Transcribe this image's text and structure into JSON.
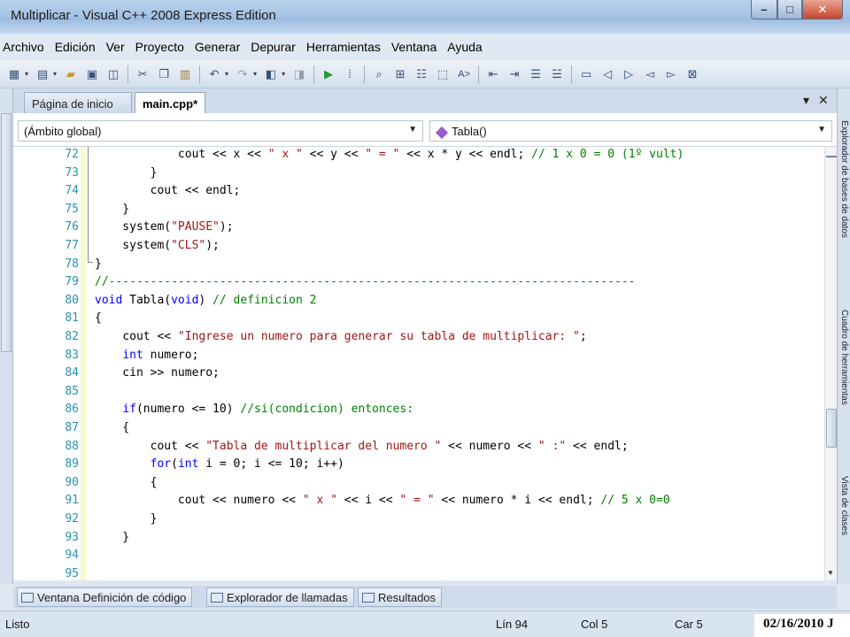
{
  "window": {
    "title": "Multiplicar - Visual C++ 2008 Express Edition"
  },
  "menu": [
    "Archivo",
    "Edición",
    "Ver",
    "Proyecto",
    "Generar",
    "Depurar",
    "Herramientas",
    "Ventana",
    "Ayuda"
  ],
  "tabs": {
    "start_page": "Página de inicio",
    "active": "main.cpp*"
  },
  "nav": {
    "scope": "(Ámbito global)",
    "member": "Tabla()"
  },
  "side_panels": {
    "right": [
      "Explorador de bases de datos",
      "Cuadro de herramientas",
      "Vista de clases"
    ]
  },
  "code_lines": [
    {
      "n": "72",
      "parts": [
        [
          "t",
          "            cout << x << "
        ],
        [
          "s",
          "\" x \""
        ],
        [
          "t",
          " << y << "
        ],
        [
          "s",
          "\" = \""
        ],
        [
          "t",
          " << x * y << endl; "
        ],
        [
          "c",
          "// 1 x 0 = 0 (1º vult)"
        ]
      ]
    },
    {
      "n": "73",
      "parts": [
        [
          "t",
          "        }"
        ]
      ]
    },
    {
      "n": "74",
      "parts": [
        [
          "t",
          "        cout << endl;"
        ]
      ]
    },
    {
      "n": "75",
      "parts": [
        [
          "t",
          "    }"
        ]
      ]
    },
    {
      "n": "76",
      "parts": [
        [
          "t",
          "    system("
        ],
        [
          "s",
          "\"PAUSE\""
        ],
        [
          "t",
          ");"
        ]
      ]
    },
    {
      "n": "77",
      "parts": [
        [
          "t",
          "    system("
        ],
        [
          "s",
          "\"CLS\""
        ],
        [
          "t",
          ");"
        ]
      ]
    },
    {
      "n": "78",
      "parts": [
        [
          "t",
          "}"
        ]
      ]
    },
    {
      "n": "79",
      "parts": [
        [
          "c",
          "//----------------------------------------------------------------------------"
        ]
      ]
    },
    {
      "n": "80",
      "parts": [
        [
          "k",
          "void"
        ],
        [
          "t",
          " Tabla("
        ],
        [
          "k",
          "void"
        ],
        [
          "t",
          ") "
        ],
        [
          "c",
          "// definicion 2"
        ]
      ]
    },
    {
      "n": "81",
      "parts": [
        [
          "t",
          "{"
        ]
      ]
    },
    {
      "n": "82",
      "parts": [
        [
          "t",
          "    cout << "
        ],
        [
          "s",
          "\"Ingrese un numero para generar su tabla de multiplicar: \""
        ],
        [
          "t",
          ";"
        ]
      ]
    },
    {
      "n": "83",
      "parts": [
        [
          "t",
          "    "
        ],
        [
          "k",
          "int"
        ],
        [
          "t",
          " numero;"
        ]
      ]
    },
    {
      "n": "84",
      "parts": [
        [
          "t",
          "    cin >> numero;"
        ]
      ]
    },
    {
      "n": "85",
      "parts": [
        [
          "t",
          ""
        ]
      ]
    },
    {
      "n": "86",
      "parts": [
        [
          "t",
          "    "
        ],
        [
          "k",
          "if"
        ],
        [
          "t",
          "(numero <= 10) "
        ],
        [
          "c",
          "//si(condicion) entonces:"
        ]
      ]
    },
    {
      "n": "87",
      "parts": [
        [
          "t",
          "    {"
        ]
      ]
    },
    {
      "n": "88",
      "parts": [
        [
          "t",
          "        cout << "
        ],
        [
          "s",
          "\"Tabla de multiplicar del numero \""
        ],
        [
          "t",
          " << numero << "
        ],
        [
          "s",
          "\" :\""
        ],
        [
          "t",
          " << endl;"
        ]
      ]
    },
    {
      "n": "89",
      "parts": [
        [
          "t",
          "        "
        ],
        [
          "k",
          "for"
        ],
        [
          "t",
          "("
        ],
        [
          "k",
          "int"
        ],
        [
          "t",
          " i = 0; i <= 10; i++)"
        ]
      ]
    },
    {
      "n": "90",
      "parts": [
        [
          "t",
          "        {"
        ]
      ]
    },
    {
      "n": "91",
      "parts": [
        [
          "t",
          "            cout << numero << "
        ],
        [
          "s",
          "\" x \""
        ],
        [
          "t",
          " << i << "
        ],
        [
          "s",
          "\" = \""
        ],
        [
          "t",
          " << numero * i << endl; "
        ],
        [
          "c",
          "// 5 x 0=0"
        ]
      ]
    },
    {
      "n": "92",
      "parts": [
        [
          "t",
          "        }"
        ]
      ]
    },
    {
      "n": "93",
      "parts": [
        [
          "t",
          "    }"
        ]
      ]
    },
    {
      "n": "94",
      "parts": [
        [
          "t",
          ""
        ]
      ]
    },
    {
      "n": "95",
      "parts": [
        [
          "t",
          ""
        ]
      ]
    }
  ],
  "bottom_tabs": [
    "Ventana Definición de código",
    "Explorador de llamadas",
    "Resultados"
  ],
  "status": {
    "text": "Listo",
    "line": "Lín 94",
    "col": "Col 5",
    "char": "Car 5"
  },
  "datestamp": "02/16/2010 J"
}
